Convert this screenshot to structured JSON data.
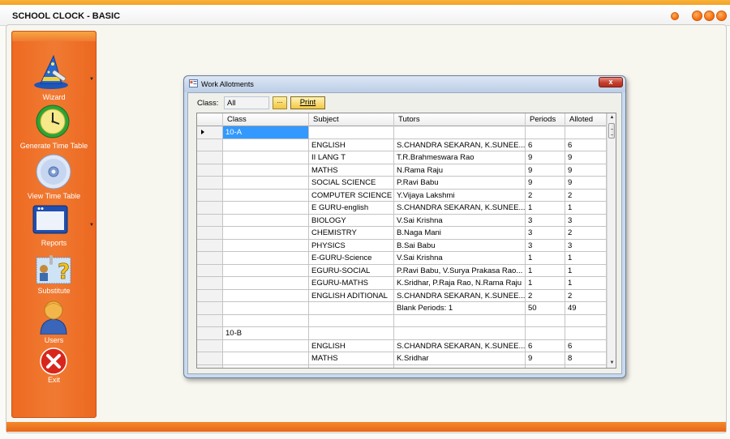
{
  "app": {
    "title": "SCHOOL CLOCK - BASIC"
  },
  "sidebar": {
    "items": [
      {
        "label": "Wizard",
        "icon": "wizard-hat-icon",
        "has_dropdown": true
      },
      {
        "label": "Generate Time Table",
        "icon": "clock-icon",
        "has_dropdown": false
      },
      {
        "label": "View Time Table",
        "icon": "disc-icon",
        "has_dropdown": false
      },
      {
        "label": "Reports",
        "icon": "window-icon",
        "has_dropdown": true
      },
      {
        "label": "Substitute",
        "icon": "substitute-question-icon",
        "has_dropdown": false
      },
      {
        "label": "Users",
        "icon": "user-icon",
        "has_dropdown": false
      },
      {
        "label": "Exit",
        "icon": "exit-x-icon",
        "has_dropdown": false
      }
    ]
  },
  "dialog": {
    "title": "Work Allotments",
    "close_label": "x",
    "class_label": "Class:",
    "class_value": "All",
    "browse_label": "...",
    "print_label": "Print"
  },
  "grid": {
    "columns": [
      "Class",
      "Subject",
      "Tutors",
      "Periods",
      "Alloted"
    ],
    "selected_row": 0,
    "rows": [
      {
        "class": "10-A",
        "subject": "",
        "tutors": "",
        "periods": "",
        "alloted": ""
      },
      {
        "class": "",
        "subject": "ENGLISH",
        "tutors": "S.CHANDRA SEKARAN, K.SUNEE...",
        "periods": "6",
        "alloted": "6"
      },
      {
        "class": "",
        "subject": "II LANG T",
        "tutors": "T.R.Brahmeswara Rao",
        "periods": "9",
        "alloted": "9"
      },
      {
        "class": "",
        "subject": "MATHS",
        "tutors": "N.Rama Raju",
        "periods": "9",
        "alloted": "9"
      },
      {
        "class": "",
        "subject": "SOCIAL SCIENCE",
        "tutors": "P.Ravi Babu",
        "periods": "9",
        "alloted": "9"
      },
      {
        "class": "",
        "subject": "COMPUTER SCIENCE",
        "tutors": "Y.Vijaya Lakshmi",
        "periods": "2",
        "alloted": "2"
      },
      {
        "class": "",
        "subject": "E GURU-english",
        "tutors": "S.CHANDRA SEKARAN, K.SUNEE...",
        "periods": "1",
        "alloted": "1"
      },
      {
        "class": "",
        "subject": "BIOLOGY",
        "tutors": "V.Sai Krishna",
        "periods": "3",
        "alloted": "3"
      },
      {
        "class": "",
        "subject": "CHEMISTRY",
        "tutors": "B.Naga Mani",
        "periods": "3",
        "alloted": "2"
      },
      {
        "class": "",
        "subject": "PHYSICS",
        "tutors": "B.Sai Babu",
        "periods": "3",
        "alloted": "3"
      },
      {
        "class": "",
        "subject": "E-GURU-Science",
        "tutors": "V.Sai Krishna",
        "periods": "1",
        "alloted": "1"
      },
      {
        "class": "",
        "subject": "EGURU-SOCIAL",
        "tutors": "P.Ravi Babu, V.Surya Prakasa Rao...",
        "periods": "1",
        "alloted": "1"
      },
      {
        "class": "",
        "subject": "EGURU-MATHS",
        "tutors": "K.Sridhar, P.Raja Rao, N.Rama Raju",
        "periods": "1",
        "alloted": "1"
      },
      {
        "class": "",
        "subject": "ENGLISH ADITIONAL",
        "tutors": "S.CHANDRA SEKARAN, K.SUNEE...",
        "periods": "2",
        "alloted": "2"
      },
      {
        "class": "",
        "subject": "",
        "tutors": "Blank Periods: 1",
        "periods": "50",
        "alloted": "49"
      },
      {
        "class": "",
        "subject": "",
        "tutors": "",
        "periods": "",
        "alloted": ""
      },
      {
        "class": "10-B",
        "subject": "",
        "tutors": "",
        "periods": "",
        "alloted": ""
      },
      {
        "class": "",
        "subject": "ENGLISH",
        "tutors": "S.CHANDRA SEKARAN, K.SUNEE...",
        "periods": "6",
        "alloted": "6"
      },
      {
        "class": "",
        "subject": "MATHS",
        "tutors": "K.Sridhar",
        "periods": "9",
        "alloted": "8"
      },
      {
        "class": "",
        "subject": "",
        "tutors": "",
        "periods": "",
        "alloted": ""
      }
    ]
  },
  "colors": {
    "accent": "#f07a32",
    "selection": "#3399ff",
    "dialog_frame": "#c9d9ee"
  }
}
